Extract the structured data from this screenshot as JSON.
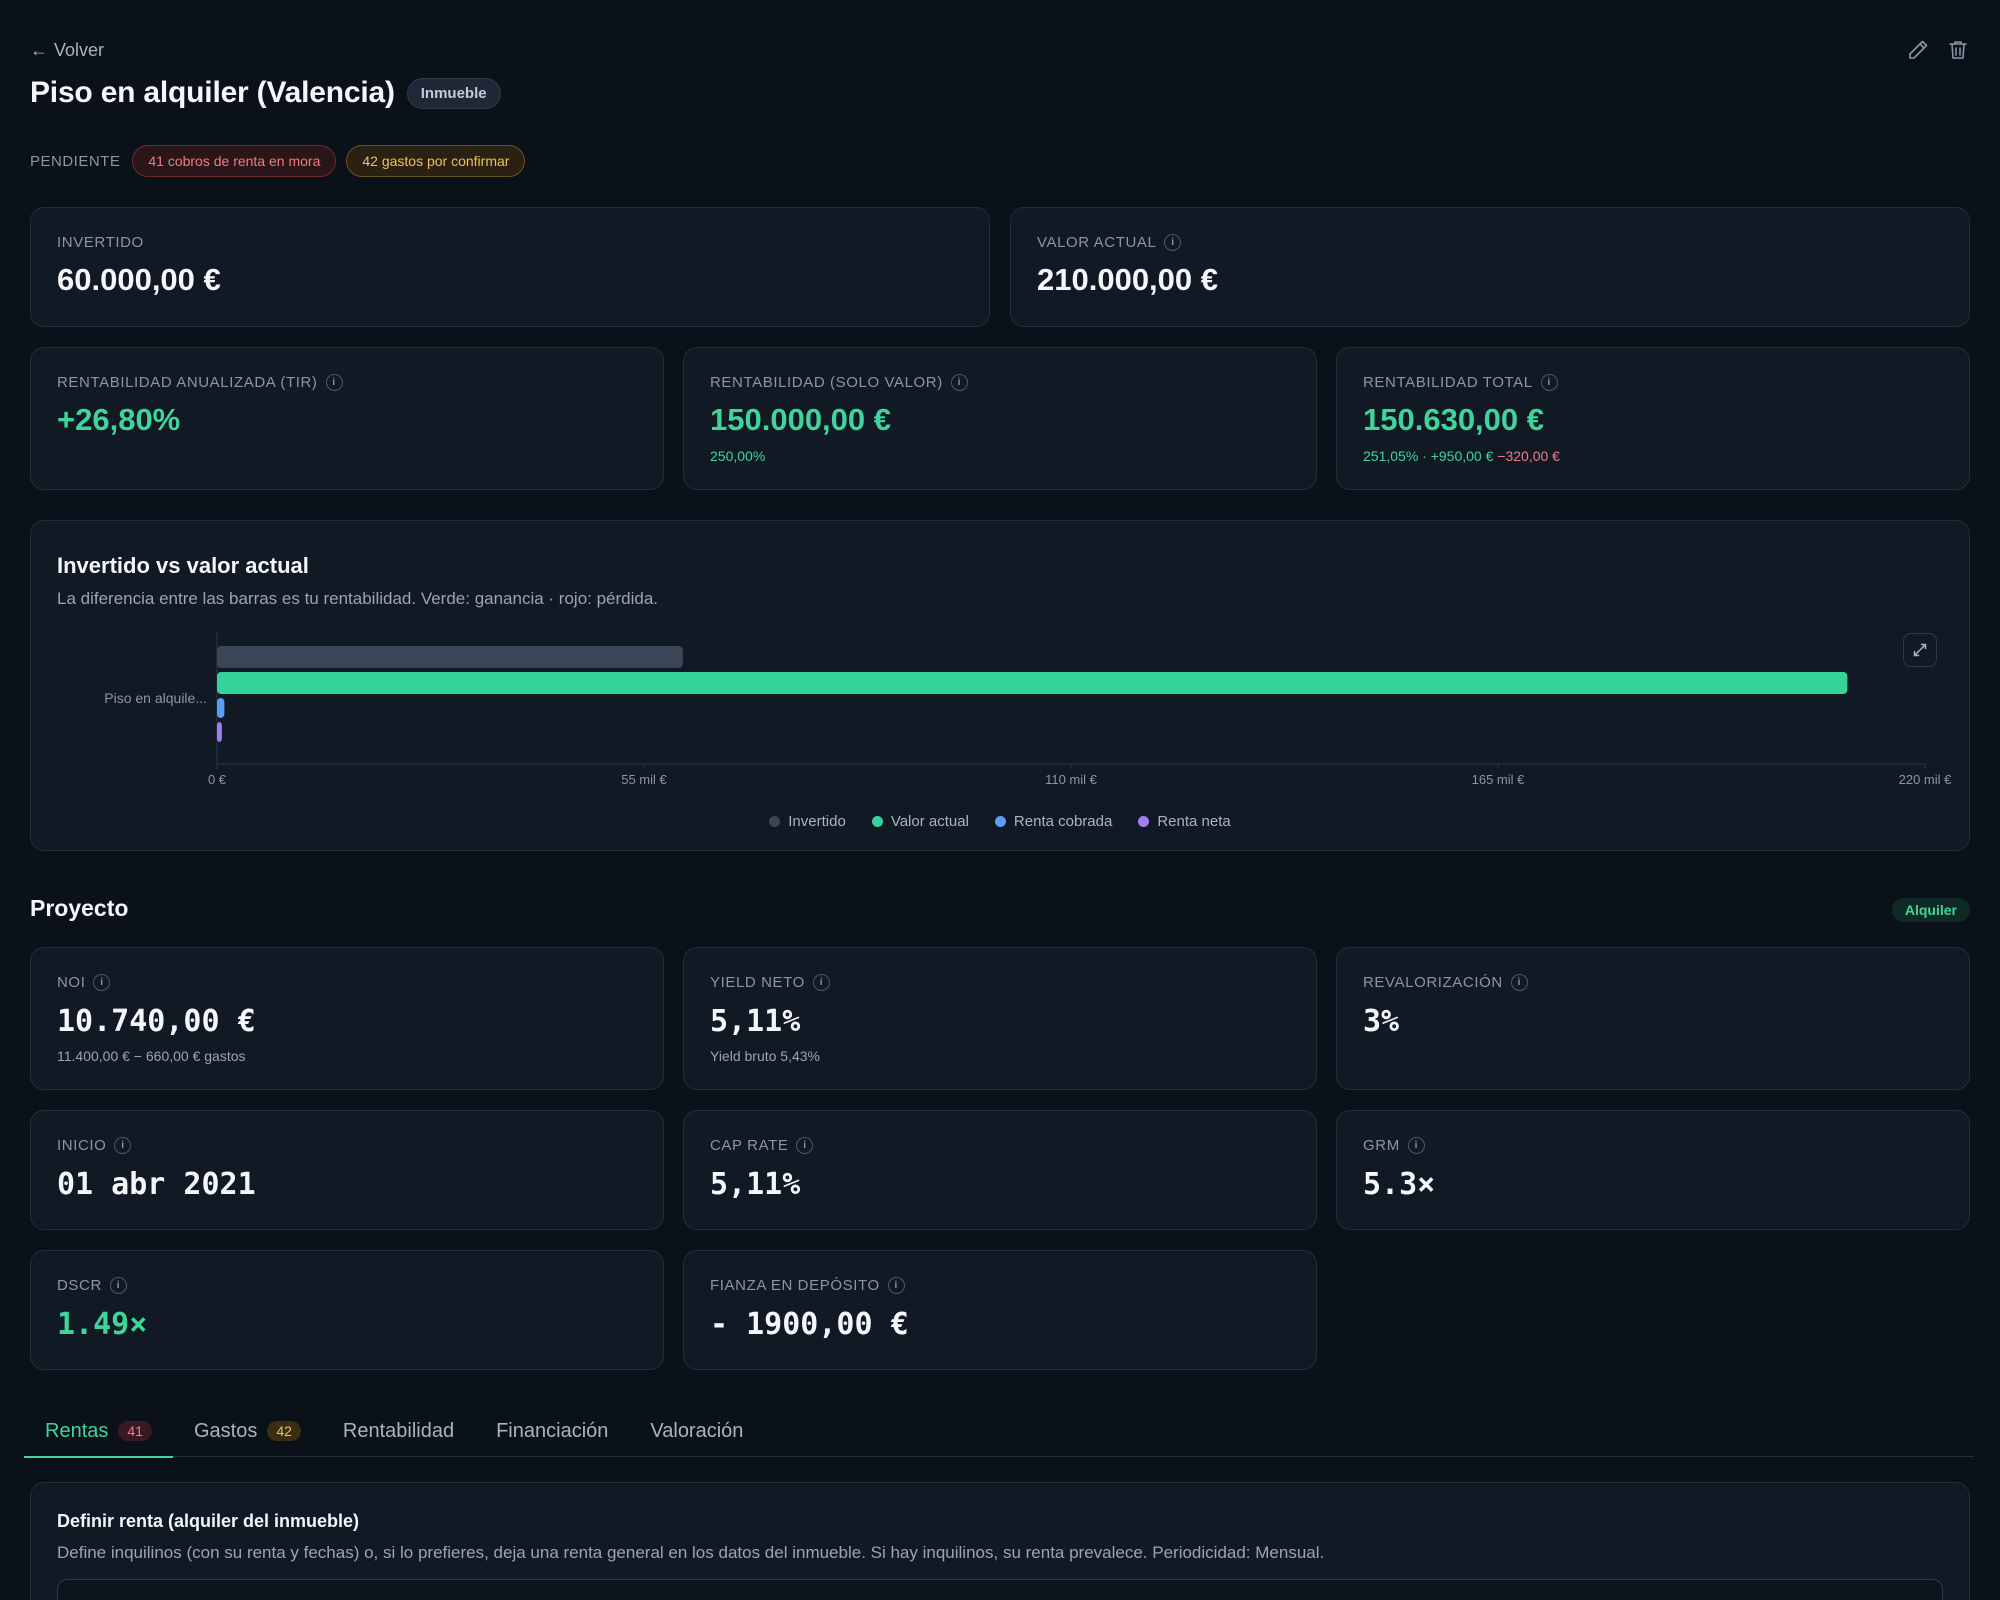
{
  "header": {
    "back_label": "Volver",
    "title": "Piso en alquiler (Valencia)",
    "type_badge": "Inmueble"
  },
  "pending": {
    "label": "PENDIENTE",
    "rent_overdue": "41 cobros de renta en mora",
    "expenses_pending": "42 gastos por confirmar"
  },
  "summary": {
    "invested": {
      "label": "INVERTIDO",
      "value": "60.000,00 €"
    },
    "current_value": {
      "label": "VALOR ACTUAL",
      "value": "210.000,00 €"
    },
    "irr": {
      "label": "RENTABILIDAD ANUALIZADA (TIR)",
      "value": "+26,80%"
    },
    "value_return": {
      "label": "RENTABILIDAD (SOLO VALOR)",
      "value": "150.000,00 €",
      "sub": "250,00%"
    },
    "total_return": {
      "label": "RENTABILIDAD TOTAL",
      "value": "150.630,00 €",
      "sub_main": "251,05% · +950,00 €",
      "sub_neg": "−320,00 €"
    }
  },
  "chart": {
    "title": "Invertido vs valor actual",
    "subtitle": "La diferencia entre las barras es tu rentabilidad. Verde: ganancia · rojo: pérdida."
  },
  "chart_data": {
    "type": "bar",
    "orientation": "horizontal",
    "categories": [
      "Piso en alquile..."
    ],
    "series": [
      {
        "name": "Invertido",
        "values": [
          60000
        ],
        "color": "#3a4658"
      },
      {
        "name": "Valor actual",
        "values": [
          210000
        ],
        "color": "#34d399"
      },
      {
        "name": "Renta cobrada",
        "values": [
          950
        ],
        "color": "#5b9cf5"
      },
      {
        "name": "Renta neta",
        "values": [
          630
        ],
        "color": "#a07cf0"
      }
    ],
    "xlim": [
      0,
      220000
    ],
    "xticks": [
      {
        "value": 0,
        "label": "0 €"
      },
      {
        "value": 55000,
        "label": "55 mil €"
      },
      {
        "value": 110000,
        "label": "110 mil €"
      },
      {
        "value": 165000,
        "label": "165 mil €"
      },
      {
        "value": 220000,
        "label": "220 mil €"
      }
    ],
    "legend": "bottom-center",
    "grid": false
  },
  "project": {
    "title": "Proyecto",
    "badge": "Alquiler",
    "noi": {
      "label": "NOI",
      "value": "10.740,00 €",
      "sub": "11.400,00 € − 660,00 € gastos"
    },
    "net_yield": {
      "label": "YIELD NETO",
      "value": "5,11%",
      "sub": "Yield bruto 5,43%"
    },
    "appreciation": {
      "label": "REVALORIZACIÓN",
      "value": "3%"
    },
    "start": {
      "label": "INICIO",
      "value": "01 abr 2021"
    },
    "cap_rate": {
      "label": "CAP RATE",
      "value": "5,11%"
    },
    "grm": {
      "label": "GRM",
      "value": "5.3×"
    },
    "dscr": {
      "label": "DSCR",
      "value": "1.49×"
    },
    "deposit": {
      "label": "FIANZA EN DEPÓSITO",
      "value": "- 1900,00 €"
    }
  },
  "tabs": [
    {
      "label": "Rentas",
      "count": "41"
    },
    {
      "label": "Gastos",
      "count": "42"
    },
    {
      "label": "Rentabilidad"
    },
    {
      "label": "Financiación"
    },
    {
      "label": "Valoración"
    }
  ],
  "rent_section": {
    "title": "Definir renta (alquiler del inmueble)",
    "description": "Define inquilinos (con su renta y fechas) o, si lo prefieres, deja una renta general en los datos del inmueble. Si hay inquilinos, su renta prevalece. Periodicidad: Mensual."
  },
  "colors": {
    "accent": "#3fd59a",
    "danger": "#f07b86",
    "warning": "#f0c15a",
    "background": "#0b1119",
    "card": "#111925"
  },
  "icons": {
    "back": "arrow-left-icon",
    "edit": "pencil-icon",
    "delete": "trash-icon",
    "info": "info-icon",
    "expand": "expand-icon"
  }
}
